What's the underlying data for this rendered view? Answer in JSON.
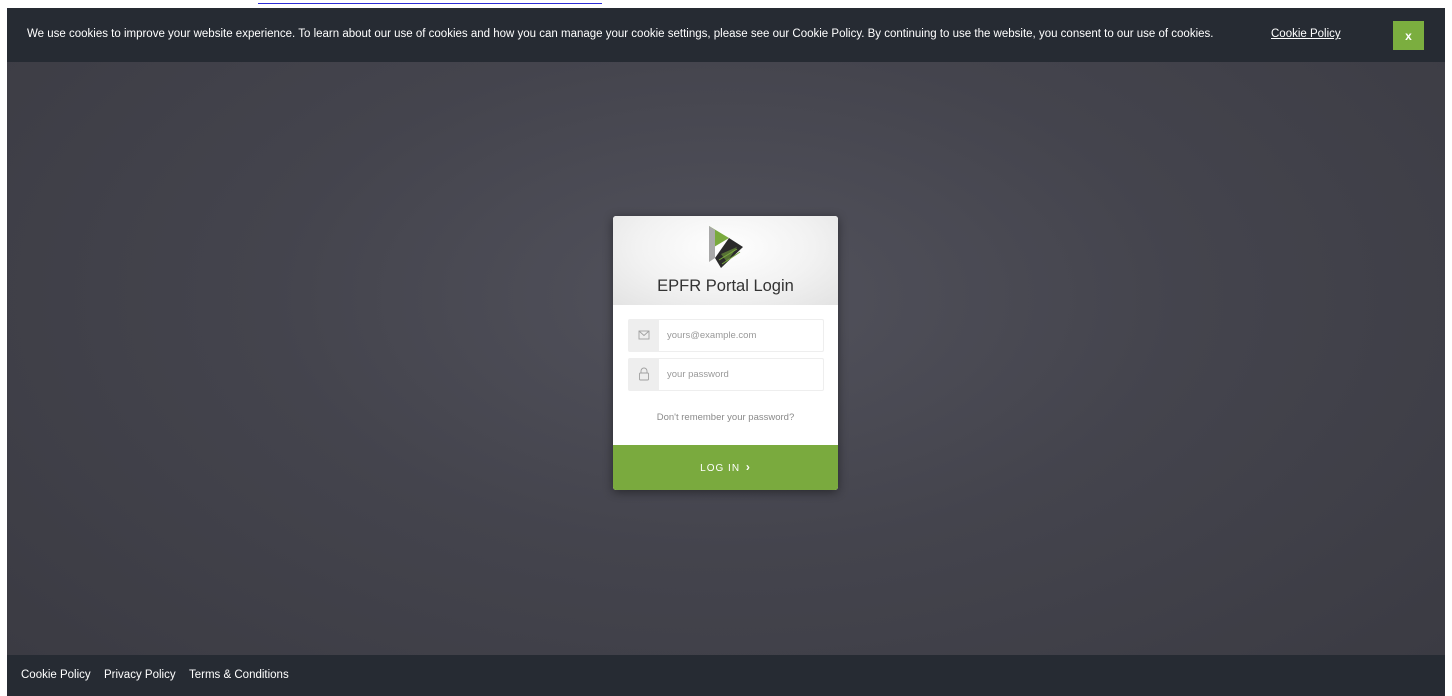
{
  "cookie_bar": {
    "message": "We use cookies to improve your website experience. To learn about our use of cookies and how you can manage your cookie settings, please see our Cookie Policy. By continuing to use the website, you consent to our use of cookies.",
    "link_label": "Cookie Policy",
    "close_label": "x",
    "background": "#262b33",
    "close_color": "#7bae3f"
  },
  "login": {
    "title": "EPFR Portal Login",
    "email_placeholder": "yours@example.com",
    "password_placeholder": "your password",
    "forgot_label": "Don't remember your password?",
    "submit_label": "LOG IN",
    "submit_chevron": "›",
    "accent": "#7aaa3e",
    "email_icon": "envelope-icon",
    "password_icon": "lock-icon",
    "logo": "epfr-logo"
  },
  "footer": {
    "links": [
      "Cookie Policy",
      "Privacy Policy",
      "Terms & Conditions"
    ],
    "background": "#262b33"
  }
}
